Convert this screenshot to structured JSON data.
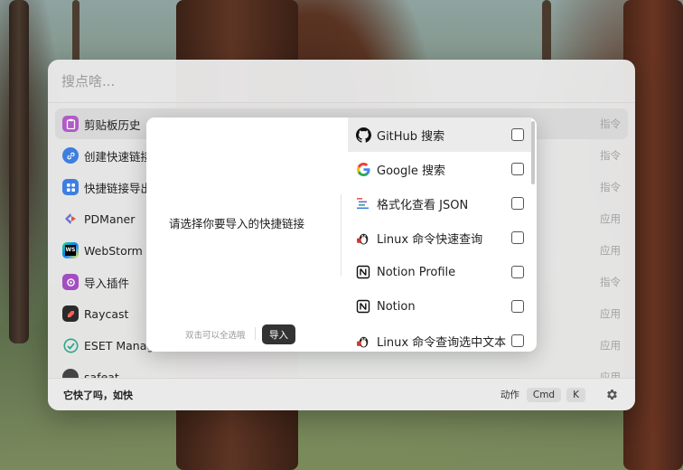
{
  "search": {
    "placeholder": "搜点啥..."
  },
  "results": [
    {
      "label": "剪贴板历史",
      "kind": "指令",
      "icon": "clipboard-icon",
      "color": "#b05bc7"
    },
    {
      "label": "创建快速链接",
      "kind": "指令",
      "icon": "link-icon",
      "color": "#3d7fe0"
    },
    {
      "label": "快捷链接导出",
      "kind": "指令",
      "icon": "grid-icon",
      "color": "#3d7fe0"
    },
    {
      "label": "PDManer",
      "kind": "应用",
      "icon": "pdmaner-icon",
      "color": "#6d6dd8"
    },
    {
      "label": "WebStorm",
      "kind": "应用",
      "icon": "webstorm-icon",
      "color": "#1f1f3a"
    },
    {
      "label": "导入插件",
      "kind": "指令",
      "icon": "plugin-icon",
      "color": "#a24ec0"
    },
    {
      "label": "Raycast",
      "kind": "应用",
      "icon": "raycast-icon",
      "color": "#2a2a2a"
    },
    {
      "label": "ESET Manage…",
      "kind": "应用",
      "icon": "eset-icon",
      "color": "#2fa58b"
    },
    {
      "label": "safeat",
      "kind": "应用",
      "icon": "safeat-icon",
      "color": "#444"
    }
  ],
  "footer": {
    "slogan": "它快了吗，如快",
    "action_label": "动作",
    "key_cmd": "Cmd",
    "key_k": "K"
  },
  "dialog": {
    "prompt": "请选择你要导入的快捷链接",
    "hint": "双击可以全选哦",
    "import_button": "导入",
    "items": [
      {
        "label": "GitHub 搜索",
        "icon": "github-icon"
      },
      {
        "label": "Google 搜索",
        "icon": "google-icon"
      },
      {
        "label": "格式化查看 JSON",
        "icon": "json-icon"
      },
      {
        "label": "Linux 命令快速查询",
        "icon": "linux-icon"
      },
      {
        "label": "Notion Profile",
        "icon": "notion-icon"
      },
      {
        "label": "Notion",
        "icon": "notion-icon"
      },
      {
        "label": "Linux 命令查询选中文本",
        "icon": "linux-icon"
      }
    ]
  }
}
